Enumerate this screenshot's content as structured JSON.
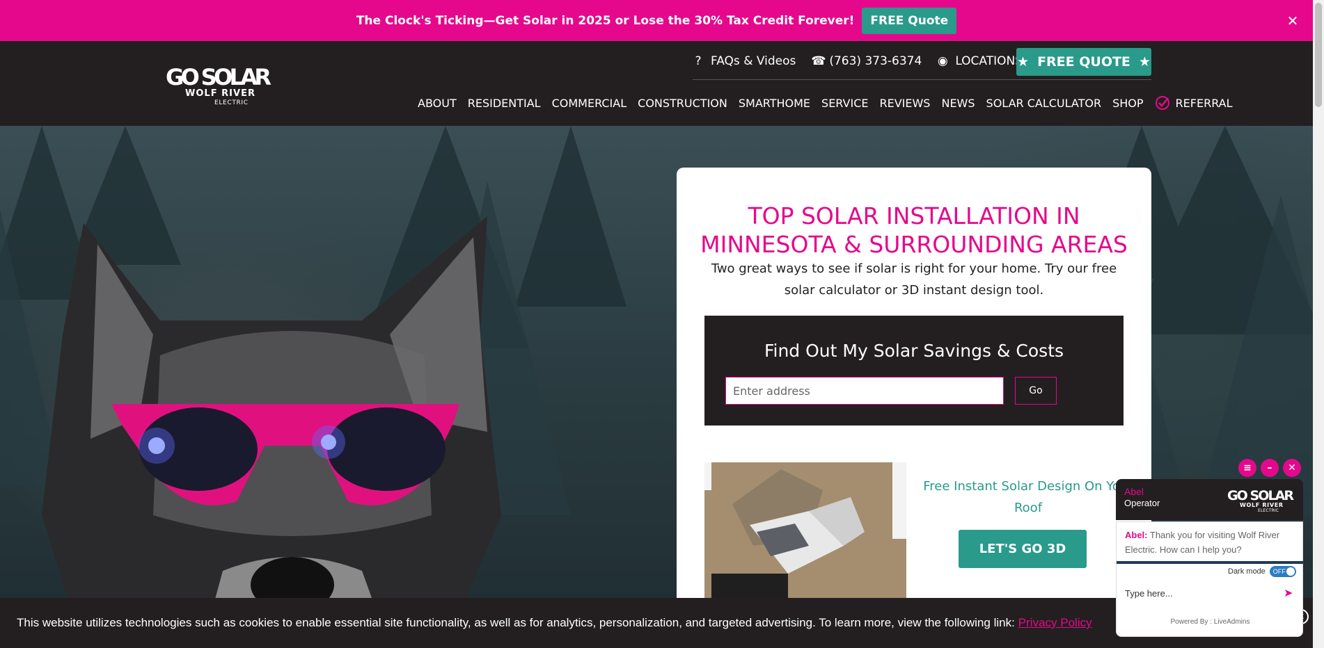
{
  "promo": {
    "text": "The Clock's Ticking—Get Solar in 2025 or Lose the 30% Tax Credit Forever!",
    "button": "FREE Quote",
    "close_icon": "✕"
  },
  "header": {
    "logo_alt": "Go Solar Wolf River Electric",
    "utility": [
      {
        "icon": "question-icon",
        "glyph": "?",
        "label": "FAQs & Videos"
      },
      {
        "icon": "phone-icon",
        "glyph": "☎",
        "label": "(763) 373-6374"
      },
      {
        "icon": "location-pin-icon",
        "glyph": "◉",
        "label": "LOCATIONS"
      }
    ],
    "free_quote": "FREE QUOTE",
    "nav": [
      "ABOUT",
      "RESIDENTIAL",
      "COMMERCIAL",
      "CONSTRUCTION",
      "SMARTHOME",
      "SERVICE",
      "REVIEWS",
      "NEWS",
      "SOLAR CALCULATOR",
      "SHOP"
    ],
    "referral": "REFERRAL"
  },
  "card": {
    "title_line1": "TOP SOLAR INSTALLATION IN",
    "title_line2": "MINNESOTA & SURROUNDING AREAS",
    "subtitle": "Two great ways to see if solar is right for your home. Try our free solar calculator or 3D instant design tool.",
    "find_title": "Find Out My Solar Savings & Costs",
    "address_placeholder": "Enter address",
    "go": "Go",
    "design_text": "Free Instant Solar Design On Your Roof",
    "go3d": "LET'S GO 3D"
  },
  "cookie": {
    "text": "This website utilizes technologies such as cookies to enable essential site functionality, as well as for analytics, personalization, and targeted advertising. To learn more, view the following link:",
    "link": "Privacy Policy"
  },
  "chat": {
    "agent": "Abel",
    "role": "Operator",
    "message_name": "Abel:",
    "message": "Thank you for visiting Wolf River Electric. How can I help you?",
    "dark_mode_label": "Dark mode",
    "toggle": "OFF",
    "input_placeholder": "Type here...",
    "powered_by": "Powered By : LiveAdmins"
  },
  "colors": {
    "brand_pink": "#e5088c",
    "brand_teal": "#2a9a8a",
    "dark": "#231f20"
  }
}
